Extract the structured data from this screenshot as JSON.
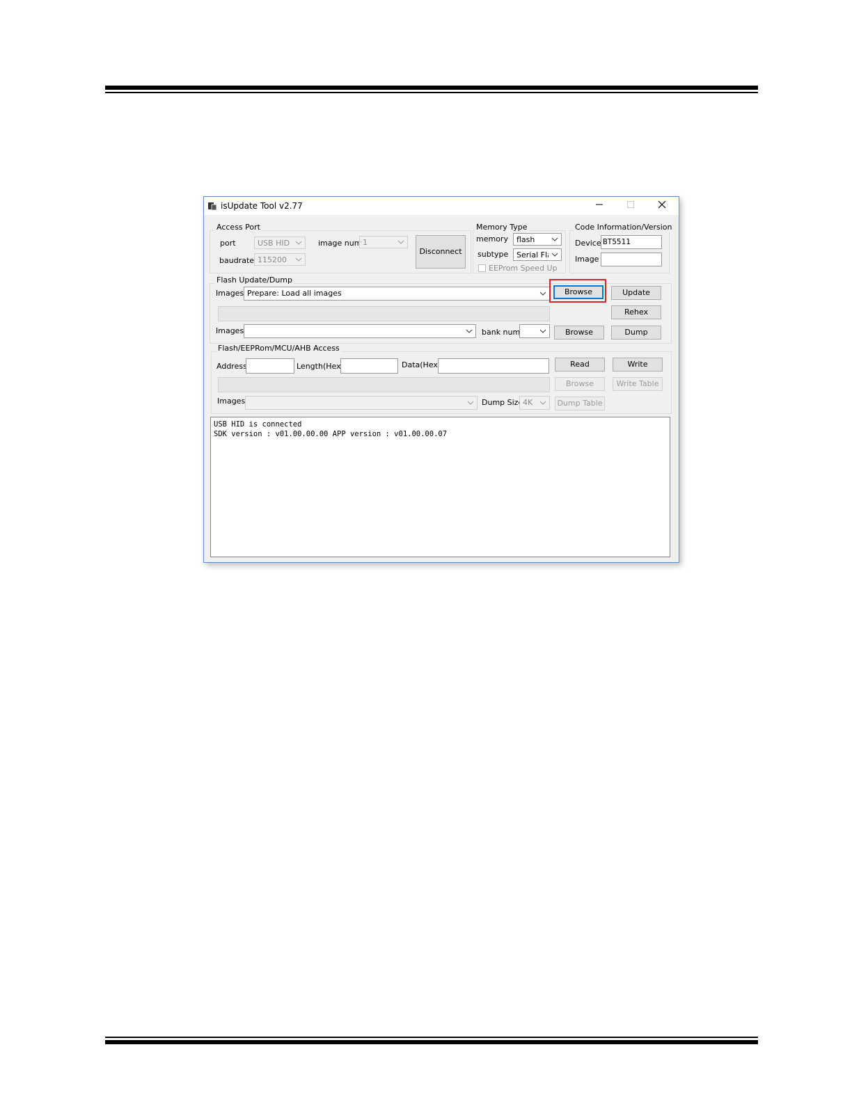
{
  "window": {
    "title": "isUpdate Tool v2.77"
  },
  "access_port": {
    "title": "Access Port",
    "port_label": "port",
    "port_value": "USB HID",
    "baudrate_label": "baudrate",
    "baudrate_value": "115200",
    "image_num_label": "image num",
    "image_num_value": "1",
    "disconnect_label": "Disconnect"
  },
  "memory_type": {
    "title": "Memory Type",
    "memory_label": "memory",
    "memory_value": "flash",
    "subtype_label": "subtype",
    "subtype_value": "Serial Flash",
    "eeprom_label": "EEProm Speed Up"
  },
  "code_info": {
    "title": "Code Information/Version",
    "device_label": "Device",
    "device_value": "BT5511",
    "image_label": "Image",
    "image_value": ""
  },
  "flash_update": {
    "title": "Flash Update/Dump",
    "images_label": "Images",
    "images_value": "Prepare: Load all images",
    "browse_label": "Browse",
    "update_label": "Update",
    "rehex_label": "Rehex",
    "images2_label": "Images",
    "images2_value": "",
    "bank_num_label": "bank num",
    "bank_num_value": "",
    "browse2_label": "Browse",
    "dump_label": "Dump"
  },
  "flash_access": {
    "title": "Flash/EEPRom/MCU/AHB Access",
    "address_label": "Address",
    "length_label": "Length(Hex)",
    "data_label": "Data(Hex)",
    "read_label": "Read",
    "write_label": "Write",
    "browse_label": "Browse",
    "write_table_label": "Write Table",
    "images_label": "Images",
    "images_value": "",
    "dump_size_label": "Dump Size",
    "dump_size_value": "4K",
    "dump_table_label": "Dump Table"
  },
  "log": {
    "text": "USB HID is connected\nSDK version : v01.00.00.00 APP version : v01.00.00.07"
  }
}
